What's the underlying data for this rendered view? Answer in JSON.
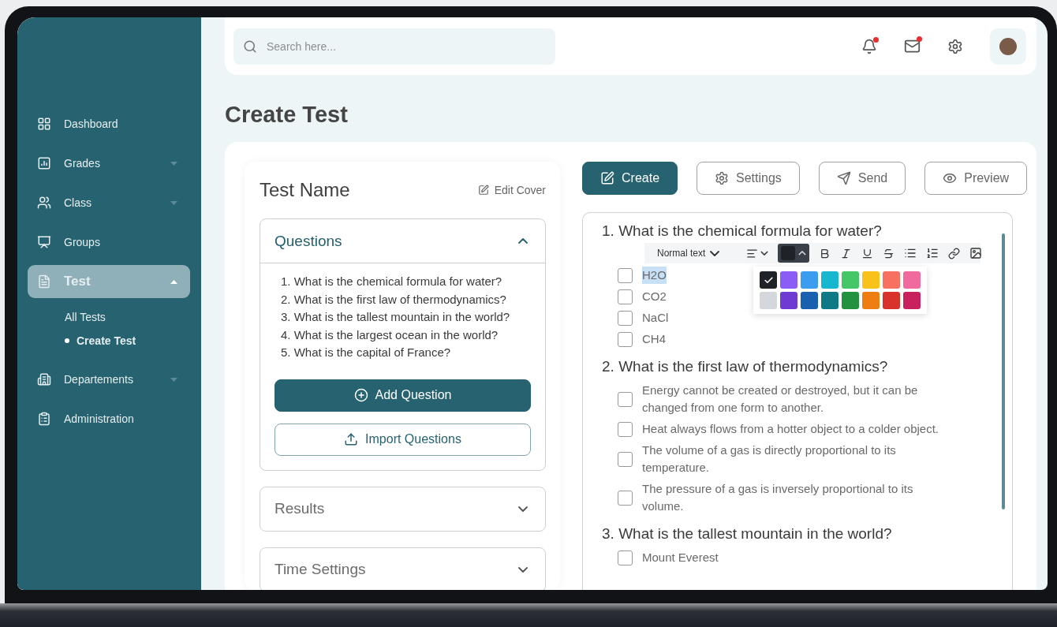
{
  "search": {
    "placeholder": "Search here..."
  },
  "header": {
    "notifications_unread": true,
    "mail_unread": true
  },
  "sidebar": {
    "items": [
      {
        "label": "Dashboard",
        "selected": false
      },
      {
        "label": "Grades",
        "selected": false,
        "expanded": false
      },
      {
        "label": "Class",
        "selected": false,
        "expanded": false
      },
      {
        "label": "Groups",
        "selected": false
      },
      {
        "label": "Test",
        "selected": true,
        "expanded": true,
        "children": [
          {
            "label": "All Tests",
            "selected": false
          },
          {
            "label": "Create Test",
            "selected": true
          }
        ]
      },
      {
        "label": "Departements",
        "selected": false,
        "expanded": false
      },
      {
        "label": "Administration",
        "selected": false
      }
    ]
  },
  "page_title": "Create Test",
  "test_panel": {
    "title": "Test Name",
    "edit_cover": "Edit Cover",
    "sections": [
      {
        "title": "Questions",
        "expanded": true,
        "items": [
          {
            "number": "1.",
            "text": "What is the chemical formula for water?"
          },
          {
            "number": "2.",
            "text": "What is the first law of thermodynamics?"
          },
          {
            "number": "3.",
            "text": "What is the tallest mountain in the world?"
          },
          {
            "number": "4.",
            "text": "What is the largest ocean in the world?"
          },
          {
            "number": "5.",
            "text": "What is the capital of France?"
          }
        ],
        "add_button": "Add Question",
        "import_button": "Import Questions"
      },
      {
        "title": "Results",
        "expanded": false
      },
      {
        "title": "Time Settings",
        "expanded": false
      }
    ]
  },
  "actions": [
    {
      "label": "Create",
      "selected": true
    },
    {
      "label": "Settings",
      "selected": false
    },
    {
      "label": "Send",
      "selected": false
    },
    {
      "label": "Preview",
      "selected": false
    }
  ],
  "editor": {
    "toolbar": {
      "text_style": "Normal text",
      "color_menu_open": true
    },
    "swatches": [
      {
        "color": "#1f2328",
        "selected": true
      },
      {
        "color": "#8b5cf6",
        "selected": false
      },
      {
        "color": "#3b9cf0",
        "selected": false
      },
      {
        "color": "#17b8cf",
        "selected": false
      },
      {
        "color": "#45c667",
        "selected": false
      },
      {
        "color": "#f9c21a",
        "selected": false
      },
      {
        "color": "#f87060",
        "selected": false
      },
      {
        "color": "#f06a9e",
        "selected": false
      },
      {
        "color": "#d4d7dc",
        "selected": false
      },
      {
        "color": "#6d3bd1",
        "selected": false
      },
      {
        "color": "#1a60b0",
        "selected": false
      },
      {
        "color": "#0f7a85",
        "selected": false
      },
      {
        "color": "#23923f",
        "selected": false
      },
      {
        "color": "#ee7d12",
        "selected": false
      },
      {
        "color": "#d8322a",
        "selected": false
      },
      {
        "color": "#c9215d",
        "selected": false
      }
    ],
    "questions": [
      {
        "number": "1.",
        "title": "What is the chemical formula for water?",
        "options": [
          {
            "text": "H2O",
            "checked": false,
            "selected": true
          },
          {
            "text": "CO2",
            "checked": false,
            "selected": false
          },
          {
            "text": "NaCl",
            "checked": false,
            "selected": false
          },
          {
            "text": "CH4",
            "checked": false,
            "selected": false
          }
        ]
      },
      {
        "number": "2.",
        "title": "What is the first law of thermodynamics?",
        "options": [
          {
            "text": "Energy cannot be created or destroyed, but it can be changed from one form to another.",
            "checked": false,
            "selected": false
          },
          {
            "text": "Heat always flows from a hotter object to a colder object.",
            "checked": false,
            "selected": false
          },
          {
            "text": "The volume of a gas is directly proportional to its temperature.",
            "checked": false,
            "selected": false
          },
          {
            "text": "The pressure of a gas is inversely proportional to its volume.",
            "checked": false,
            "selected": false
          }
        ]
      },
      {
        "number": "3.",
        "title": "What is the tallest mountain in the world?",
        "options": [
          {
            "text": "Mount Everest",
            "checked": false,
            "selected": false
          }
        ]
      }
    ]
  }
}
